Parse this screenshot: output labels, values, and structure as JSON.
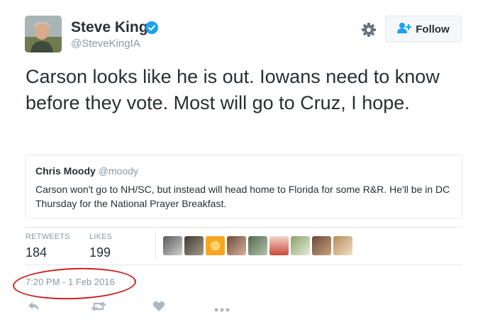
{
  "author": {
    "display_name": "Steve King",
    "handle": "@SteveKingIA",
    "verified": true
  },
  "follow_button": {
    "label": "Follow"
  },
  "tweet": {
    "text": "Carson looks like he is out. Iowans need to know before they vote. Most will go to Cruz, I hope."
  },
  "quoted_tweet": {
    "name": "Chris Moody",
    "handle": "@moody",
    "text": "Carson won't go to NH/SC, but instead will head home to Florida for some R&R. He'll be in DC Thursday for the National Prayer Breakfast."
  },
  "stats": {
    "retweets_label": "RETWEETS",
    "retweets_count": "184",
    "likes_label": "LIKES",
    "likes_count": "199"
  },
  "likers": [
    "avatar",
    "avatar",
    "avatar",
    "avatar",
    "avatar",
    "avatar",
    "avatar",
    "avatar",
    "avatar"
  ],
  "timestamp": "7:20 PM - 1 Feb 2016",
  "actions": [
    "reply-icon",
    "retweet-icon",
    "like-icon",
    "more-icon"
  ],
  "colors": {
    "text": "#292f33",
    "muted": "#8899a6",
    "verified": "#1da1f2",
    "border": "#e1e8ed",
    "annotation_circle": "#cc1f1f"
  }
}
